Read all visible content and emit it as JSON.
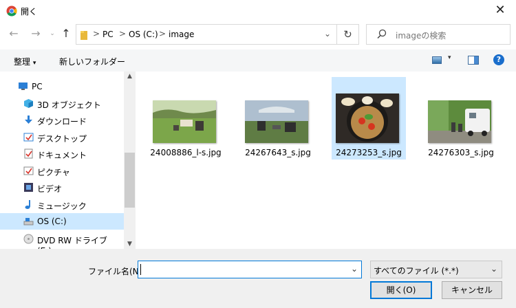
{
  "window": {
    "title": "開く"
  },
  "address": {
    "crumbs": [
      "PC",
      "OS (C:)",
      "image"
    ],
    "separator": ">"
  },
  "search": {
    "placeholder": "imageの検索"
  },
  "toolbar": {
    "organize": "整理",
    "organize_arrow": "▾",
    "new_folder": "新しいフォルダー",
    "help": "?"
  },
  "sidebar": {
    "items": [
      {
        "label": "PC",
        "icon": "pc-icon"
      },
      {
        "label": "3D オブジェクト",
        "icon": "3d-objects-icon"
      },
      {
        "label": "ダウンロード",
        "icon": "download-icon"
      },
      {
        "label": "デスクトップ",
        "icon": "desktop-icon"
      },
      {
        "label": "ドキュメント",
        "icon": "documents-icon"
      },
      {
        "label": "ピクチャ",
        "icon": "pictures-icon"
      },
      {
        "label": "ビデオ",
        "icon": "videos-icon"
      },
      {
        "label": "ミュージック",
        "icon": "music-icon"
      },
      {
        "label": "OS (C:)",
        "icon": "drive-icon",
        "selected": true
      },
      {
        "label": "DVD RW ドライブ (E:)",
        "icon": "dvd-drive-icon"
      }
    ]
  },
  "files": [
    {
      "name": "24008886_l-s.jpg",
      "thumb": "camping-chairs-meadow"
    },
    {
      "name": "24267643_s.jpg",
      "thumb": "camping-chairs-tarp"
    },
    {
      "name": "24273253_s.jpg",
      "thumb": "skillet-food",
      "selected": true
    },
    {
      "name": "24276303_s.jpg",
      "thumb": "camper-van-forest"
    }
  ],
  "footer": {
    "filename_label": "ファイル名(N):",
    "filename_value": "",
    "filter_value": "すべてのファイル (*.*)",
    "open_label": "開く(O)",
    "cancel_label": "キャンセル"
  },
  "colors": {
    "selection": "#cce8ff",
    "accent": "#0078d7"
  }
}
